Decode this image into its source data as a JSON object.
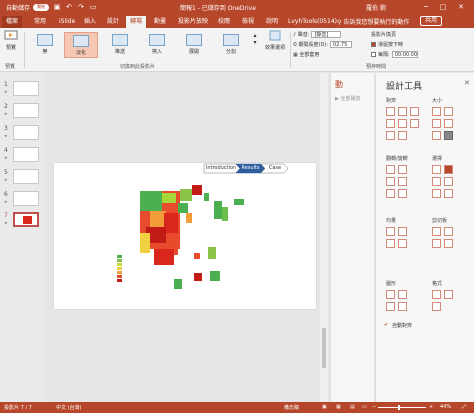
{
  "titlebar": {
    "autosave": "自動儲存",
    "toggle": "關閉",
    "doc_title": "簡報1 - 已儲存到 OneDrive",
    "user": "羅伯 劉",
    "min": "─",
    "max": "□",
    "close": "✕"
  },
  "tabs": [
    {
      "label": "檔案"
    },
    {
      "label": "常用"
    },
    {
      "label": "iSlide"
    },
    {
      "label": "插入"
    },
    {
      "label": "設計"
    },
    {
      "label": "轉場"
    },
    {
      "label": "動畫"
    },
    {
      "label": "投影片放映"
    },
    {
      "label": "校閱"
    },
    {
      "label": "檢視"
    },
    {
      "label": "說明"
    },
    {
      "label": "LvyhTools(0514)"
    }
  ],
  "search_text": "告訴我您想要執行的動作",
  "share": "共用",
  "ribbon": {
    "preview": "預覽",
    "transitions": [
      {
        "label": "無"
      },
      {
        "label": "淡化"
      },
      {
        "label": "推送"
      },
      {
        "label": "擦入"
      },
      {
        "label": "展開"
      },
      {
        "label": "分割"
      }
    ],
    "effect_options": "效果選項",
    "group_preview": "預覽",
    "group_transitions": "切換到此投影片",
    "group_timing": "預存時間",
    "sound_label": "聲音:",
    "sound_value": "[靜音]",
    "duration_label": "期間長度(D):",
    "duration_value": "02.75",
    "apply_all": "全部套用",
    "advance_title": "投影片換頁",
    "on_click": "滑鼠按下時",
    "after": "每隔:",
    "after_value": "00:00.00"
  },
  "thumbs": [
    {
      "num": "1"
    },
    {
      "num": "2"
    },
    {
      "num": "3"
    },
    {
      "num": "4"
    },
    {
      "num": "5"
    },
    {
      "num": "6"
    },
    {
      "num": "7"
    }
  ],
  "slide": {
    "chevrons": [
      "Introduction",
      "Results",
      "Case"
    ]
  },
  "anim_pane": {
    "title": "動",
    "play": "全部播放"
  },
  "tools": {
    "title": "設計工具",
    "sections": {
      "align": "對齊",
      "size": "大小",
      "rotate": "翻轉/旋轉",
      "select": "選擇",
      "distribute": "均量",
      "clip": "剪切板",
      "shape": "圖形",
      "format": "格式"
    },
    "auto_align": "自動對齊"
  },
  "status": {
    "slide": "投影片 7 / 7",
    "language": "中文 (台灣)",
    "notes": "備忘稿",
    "zoom": "44%"
  },
  "colors": {
    "accent": "#b7472a",
    "map_hot": "#d9271e",
    "map_warm": "#f39c3a",
    "map_cool": "#4caf50"
  }
}
